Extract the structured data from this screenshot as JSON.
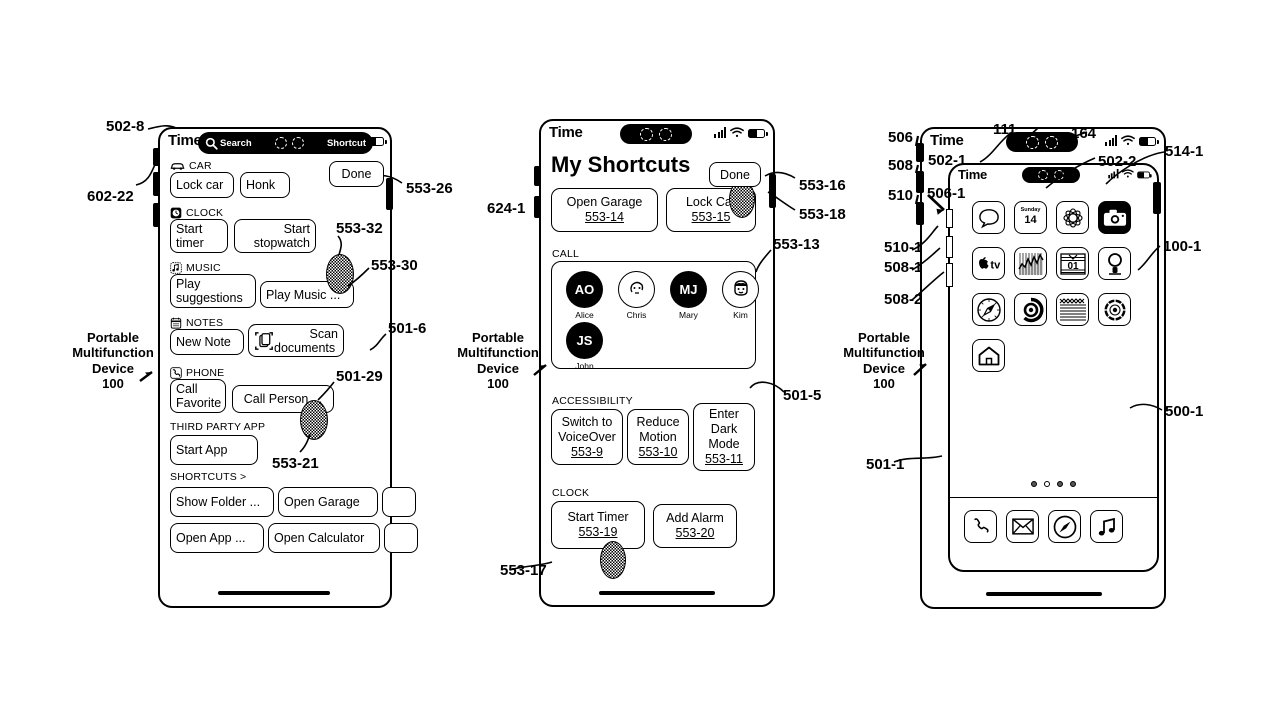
{
  "figure": {
    "device_caption": "Portable\nMultifunction\nDevice\n100",
    "caption_line1": "Portable",
    "caption_line2": "Multifunction",
    "caption_line3": "Device",
    "caption_line4": "100"
  },
  "device1": {
    "status": {
      "time": "Time"
    },
    "search_pill": {
      "search_label": "Search",
      "shortcut_label": "Shortcut",
      "search_icon": "search-icon"
    },
    "done_label": "Done",
    "sections": [
      {
        "header": "CAR",
        "icon": "car-icon",
        "buttons": [
          {
            "label": "Lock car"
          },
          {
            "label": "Honk"
          }
        ]
      },
      {
        "header": "CLOCK",
        "icon": "clock-icon",
        "buttons": [
          {
            "label": "Start\ntimer",
            "l1": "Start",
            "l2": "timer"
          },
          {
            "label": "Start\nstopwatch",
            "l1": "Start",
            "l2": "stopwatch"
          }
        ]
      },
      {
        "header": "MUSIC",
        "icon": "music-note-icon",
        "buttons": [
          {
            "label": "Play\nsuggestions",
            "l1": "Play",
            "l2": "suggestions"
          },
          {
            "label": "Play Music ..."
          }
        ]
      },
      {
        "header": "NOTES",
        "icon": "notes-icon",
        "buttons": [
          {
            "label": "New Note"
          },
          {
            "label": "Scan\ndocuments",
            "l1": "Scan",
            "l2": "documents",
            "icon": "scan-documents-icon"
          }
        ]
      },
      {
        "header": "PHONE",
        "icon": "phone-handset-icon",
        "buttons": [
          {
            "label": "Call\nFavorite",
            "l1": "Call",
            "l2": "Favorite"
          },
          {
            "label": "Call Person ..."
          }
        ]
      },
      {
        "header": "THIRD PARTY APP",
        "icon": "none",
        "buttons": [
          {
            "label": "Start App"
          }
        ]
      },
      {
        "header": "SHORTCUTS >",
        "icon": "none",
        "buttons": [
          {
            "label": "Show Folder ..."
          },
          {
            "label": "Open Garage"
          },
          {
            "label": "Open App ..."
          },
          {
            "label": "Open Calculator"
          }
        ]
      }
    ],
    "refs": [
      {
        "id": "502-8"
      },
      {
        "id": "602-22"
      },
      {
        "id": "553-26"
      },
      {
        "id": "553-32"
      },
      {
        "id": "553-30"
      },
      {
        "id": "501-6"
      },
      {
        "id": "501-29"
      },
      {
        "id": "553-21"
      }
    ]
  },
  "device2": {
    "status": {
      "time": "Time",
      "signal_icon": "cellular-signal-icon",
      "wifi_icon": "wifi-icon",
      "battery_icon": "battery-icon"
    },
    "title": "My Shortcuts",
    "done_label": "Done",
    "top_shortcuts": [
      {
        "label": "Open Garage",
        "ref": "553-14"
      },
      {
        "label": "Lock Car",
        "ref": "553-15"
      }
    ],
    "call": {
      "header": "CALL",
      "contacts": [
        {
          "initials": "AO",
          "name": "Alice",
          "style": "dark"
        },
        {
          "initials": "",
          "name": "Chris",
          "style": "light",
          "face": "face-icon"
        },
        {
          "initials": "MJ",
          "name": "Mary",
          "style": "dark"
        },
        {
          "initials": "",
          "name": "Kim",
          "style": "light",
          "face": "face-icon"
        },
        {
          "initials": "JS",
          "name": "John",
          "style": "dark"
        }
      ]
    },
    "accessibility": {
      "header": "ACCESSIBILITY",
      "buttons": [
        {
          "l1": "Switch to",
          "l2": "VoiceOver",
          "ref": "553-9"
        },
        {
          "l1": "Reduce",
          "l2": "Motion",
          "ref": "553-10"
        },
        {
          "l1": "Enter",
          "l2": "Dark",
          "l3": "Mode",
          "ref": "553-11"
        }
      ]
    },
    "clock": {
      "header": "CLOCK",
      "buttons": [
        {
          "label": "Start Timer",
          "ref": "553-19"
        },
        {
          "label": "Add Alarm",
          "ref": "553-20"
        }
      ]
    },
    "refs": [
      {
        "id": "624-1"
      },
      {
        "id": "553-16"
      },
      {
        "id": "553-18"
      },
      {
        "id": "553-13"
      },
      {
        "id": "501-5"
      },
      {
        "id": "553-17"
      }
    ]
  },
  "device3": {
    "outer_status": {
      "time": "Time"
    },
    "inner_status": {
      "time": "Time"
    },
    "apps_row1": [
      {
        "name": "messages-icon"
      },
      {
        "name": "calendar-icon",
        "weekday": "Sunday",
        "day": "14"
      },
      {
        "name": "photos-icon"
      },
      {
        "name": "camera-icon"
      }
    ],
    "apps_row2": [
      {
        "name": "apple-tv-icon",
        "label": "tv"
      },
      {
        "name": "stocks-icon"
      },
      {
        "name": "news-icon",
        "label": "01"
      },
      {
        "name": "podcasts-icon"
      }
    ],
    "apps_row3": [
      {
        "name": "compass-icon"
      },
      {
        "name": "app-store-icon"
      },
      {
        "name": "books-icon"
      },
      {
        "name": "settings-icon"
      }
    ],
    "apps_row4": [
      {
        "name": "home-icon"
      }
    ],
    "page_dots": [
      "filled",
      "empty",
      "filled",
      "filled"
    ],
    "dock": [
      {
        "name": "phone-icon"
      },
      {
        "name": "mail-icon"
      },
      {
        "name": "safari-icon"
      },
      {
        "name": "music-icon"
      }
    ],
    "refs": [
      {
        "id": "506"
      },
      {
        "id": "508"
      },
      {
        "id": "510"
      },
      {
        "id": "510-1"
      },
      {
        "id": "508-1"
      },
      {
        "id": "508-2"
      },
      {
        "id": "506-1"
      },
      {
        "id": "502-1"
      },
      {
        "id": "502-2"
      },
      {
        "id": "111"
      },
      {
        "id": "164"
      },
      {
        "id": "514-1"
      },
      {
        "id": "100-1"
      },
      {
        "id": "500-1"
      },
      {
        "id": "501-1"
      }
    ]
  }
}
